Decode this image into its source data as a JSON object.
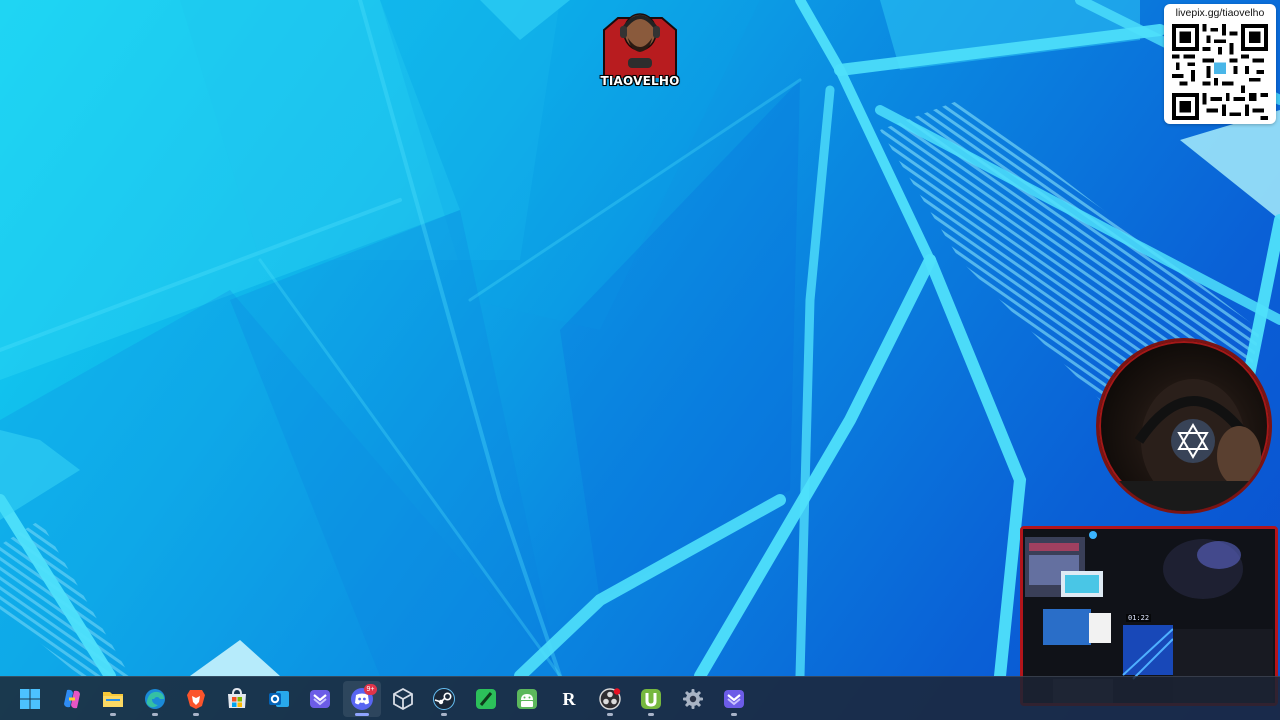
{
  "desktop": {
    "logo": {
      "label": "TIAOVELHO"
    },
    "qr_widget": {
      "url": "livepix.gg/tiaovelho"
    },
    "room_camera": {
      "clock": "01:22"
    }
  },
  "taskbar": {
    "items": [
      {
        "name": "windows-start",
        "icon": "windows-logo-icon"
      },
      {
        "name": "copilot",
        "icon": "copilot-icon"
      },
      {
        "name": "file-explorer",
        "icon": "folder-icon"
      },
      {
        "name": "edge",
        "icon": "edge-browser-icon"
      },
      {
        "name": "brave",
        "icon": "brave-lion-icon"
      },
      {
        "name": "microsoft-store",
        "icon": "store-bag-icon"
      },
      {
        "name": "outlook",
        "icon": "outlook-icon"
      },
      {
        "name": "overlay-app",
        "icon": "overlay-app-icon"
      },
      {
        "name": "discord",
        "icon": "discord-icon",
        "badge": "9+"
      },
      {
        "name": "unity",
        "icon": "unity-cube-icon"
      },
      {
        "name": "steam",
        "icon": "steam-icon"
      },
      {
        "name": "green-app",
        "icon": "green-slash-icon"
      },
      {
        "name": "android-app",
        "icon": "android-icon"
      },
      {
        "name": "r-app",
        "icon": "letter-r-icon",
        "label": "R"
      },
      {
        "name": "obs-studio",
        "icon": "obs-recording-icon"
      },
      {
        "name": "utorrent",
        "icon": "utorrent-icon"
      },
      {
        "name": "settings",
        "icon": "gear-icon"
      },
      {
        "name": "overlay-app-2",
        "icon": "overlay-app-icon"
      }
    ],
    "colors": {
      "windows": "#4cc2ff",
      "discord": "#5865f2",
      "steam": "#1b2838",
      "brave": "#fb542b",
      "green": "#2cc05a"
    }
  }
}
